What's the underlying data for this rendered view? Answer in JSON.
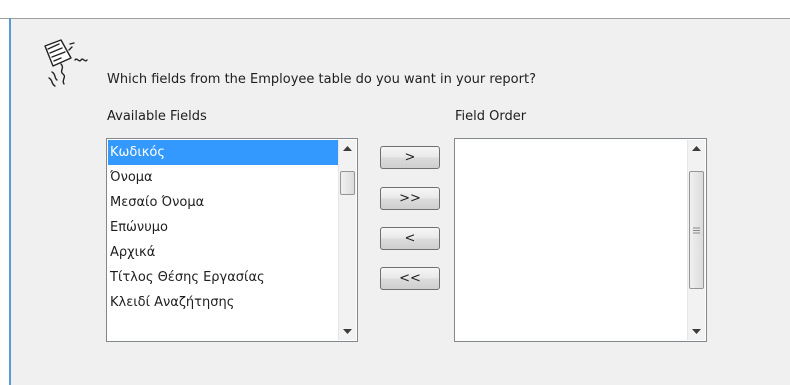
{
  "dialog": {
    "question": "Which fields from the Employee table do you want in your report?"
  },
  "available_fields": {
    "label": "Available Fields",
    "items": [
      {
        "label": "Κωδικός",
        "selected": true
      },
      {
        "label": "Όνομα",
        "selected": false
      },
      {
        "label": "Μεσαίο Όνομα",
        "selected": false
      },
      {
        "label": "Επώνυμο",
        "selected": false
      },
      {
        "label": "Αρχικά",
        "selected": false
      },
      {
        "label": "Τίτλος Θέσης Εργασίας",
        "selected": false
      },
      {
        "label": "Κλειδί Αναζήτησης",
        "selected": false
      }
    ]
  },
  "field_order": {
    "label": "Field Order",
    "items": []
  },
  "buttons": {
    "add": ">",
    "add_all": ">>",
    "remove": "<",
    "remove_all": "<<"
  },
  "colors": {
    "selection": "#3399ff",
    "panel_background": "#f0f0f0",
    "window_accent": "#5b9bd5"
  }
}
